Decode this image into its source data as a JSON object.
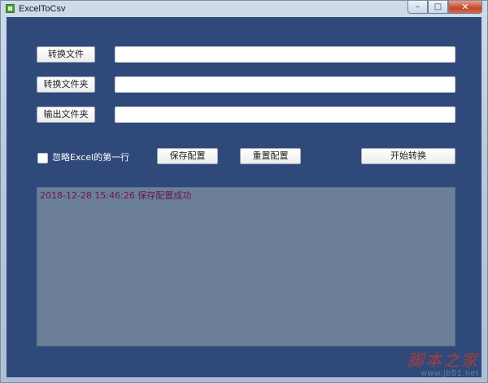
{
  "window": {
    "title": "ExcelToCsv",
    "minimize_glyph": "–",
    "maximize_glyph": "□",
    "close_glyph": "✕"
  },
  "rows": [
    {
      "button_label": "转换文件",
      "value": ""
    },
    {
      "button_label": "转换文件夹",
      "value": ""
    },
    {
      "button_label": "输出文件夹",
      "value": ""
    }
  ],
  "options": {
    "ignore_first_row_label": "忽略Excel的第一行",
    "ignore_first_row_checked": false
  },
  "actions": {
    "save_config": "保存配置",
    "reset_config": "重置配置",
    "start_convert": "开始转换"
  },
  "log": {
    "lines": [
      "2018-12-28 15:46:26  保存配置成功"
    ]
  },
  "watermark": {
    "main": "脚本之家",
    "url": "www.jb51.net"
  }
}
